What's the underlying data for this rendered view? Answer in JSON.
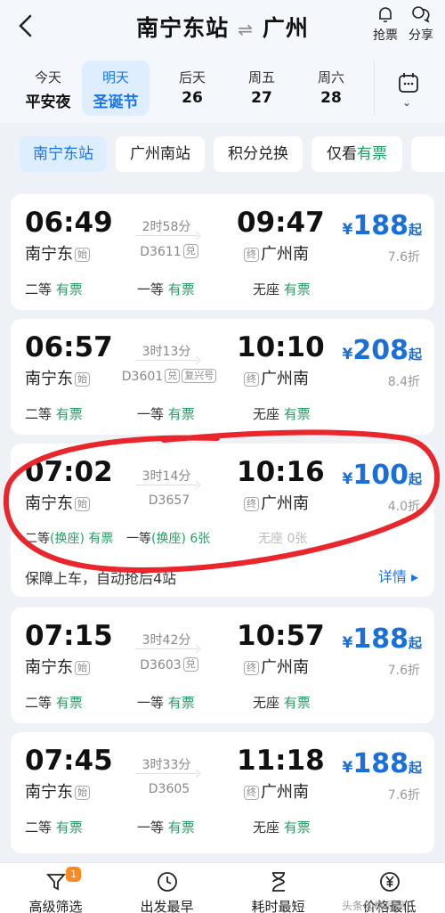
{
  "header": {
    "from": "南宁东站",
    "to": "广州",
    "swap_icon": "swap-arrows-icon",
    "grab_label": "抢票",
    "share_label": "分享"
  },
  "dates": [
    {
      "top": "今天",
      "bottom": "平安夜",
      "active": false
    },
    {
      "top": "明天",
      "bottom": "圣诞节",
      "active": true
    },
    {
      "top": "后天",
      "bottom": "26",
      "active": false
    },
    {
      "top": "周五",
      "bottom": "27",
      "active": false
    },
    {
      "top": "周六",
      "bottom": "28",
      "active": false
    }
  ],
  "filters": {
    "station_from": "南宁东站",
    "station_to": "广州南站",
    "points": "积分兑换",
    "only_label": "仅看",
    "only_value": "有票"
  },
  "trains": [
    {
      "dep": "06:49",
      "dep_station": "南宁东",
      "dep_tag": "始",
      "duration": "2时58分",
      "train_no": "D3611",
      "train_tag": "兑",
      "arr": "09:47",
      "arr_station": "广州南",
      "arr_tag": "终",
      "yen": "¥",
      "price": "188",
      "qi": "起",
      "discount": "7.6折",
      "seats": [
        {
          "label": "二等",
          "status": "有票"
        },
        {
          "label": "一等",
          "status": "有票"
        },
        {
          "label": "无座",
          "status": "有票"
        }
      ]
    },
    {
      "dep": "06:57",
      "dep_station": "南宁东",
      "dep_tag": "始",
      "duration": "3时13分",
      "train_no": "D3601",
      "train_tag": "兑",
      "train_tag2": "复兴号",
      "arr": "10:10",
      "arr_station": "广州南",
      "arr_tag": "终",
      "yen": "¥",
      "price": "208",
      "qi": "起",
      "discount": "8.4折",
      "seats": [
        {
          "label": "二等",
          "status": "有票"
        },
        {
          "label": "一等",
          "status": "有票"
        },
        {
          "label": "无座",
          "status": "有票"
        }
      ]
    },
    {
      "dep": "07:02",
      "dep_station": "南宁东",
      "dep_tag": "始",
      "duration": "3时14分",
      "train_no": "D3657",
      "arr": "10:16",
      "arr_station": "广州南",
      "arr_tag": "终",
      "yen": "¥",
      "price": "100",
      "qi": "起",
      "discount": "4.0折",
      "seats": [
        {
          "label": "二等",
          "switch": "(换座)",
          "status": "有票"
        },
        {
          "label": "一等",
          "switch": "(换座)",
          "status": "6张"
        },
        {
          "label": "无座",
          "status": "0张"
        }
      ],
      "note": "保障上车，自动抢后4站",
      "detail": "详情 ▸"
    },
    {
      "dep": "07:15",
      "dep_station": "南宁东",
      "dep_tag": "始",
      "duration": "3时42分",
      "train_no": "D3603",
      "train_tag": "兑",
      "arr": "10:57",
      "arr_station": "广州南",
      "arr_tag": "终",
      "yen": "¥",
      "price": "188",
      "qi": "起",
      "discount": "7.6折",
      "seats": [
        {
          "label": "二等",
          "status": "有票"
        },
        {
          "label": "一等",
          "status": "有票"
        },
        {
          "label": "无座",
          "status": "有票"
        }
      ]
    },
    {
      "dep": "07:45",
      "dep_station": "南宁东",
      "dep_tag": "始",
      "duration": "3时33分",
      "train_no": "D3605",
      "arr": "11:18",
      "arr_station": "广州南",
      "arr_tag": "终",
      "yen": "¥",
      "price": "188",
      "qi": "起",
      "discount": "7.6折",
      "seats": [
        {
          "label": "二等",
          "status": "有票"
        },
        {
          "label": "一等",
          "status": "有票"
        },
        {
          "label": "无座",
          "status": "有票"
        }
      ]
    }
  ],
  "bottom_nav": [
    {
      "label": "高级筛选",
      "icon": "filter-icon",
      "badge": "1"
    },
    {
      "label": "出发最早",
      "icon": "clock-icon"
    },
    {
      "label": "耗时最短",
      "icon": "hourglass-icon"
    },
    {
      "label": "价格最低",
      "icon": "yuan-icon"
    }
  ],
  "watermark": "头条@格局高",
  "colors": {
    "accent": "#1a73e8",
    "available": "#23a065",
    "price": "#1a6fd8",
    "highlight_ring": "#e8262b",
    "badge": "#ff8a1f"
  }
}
